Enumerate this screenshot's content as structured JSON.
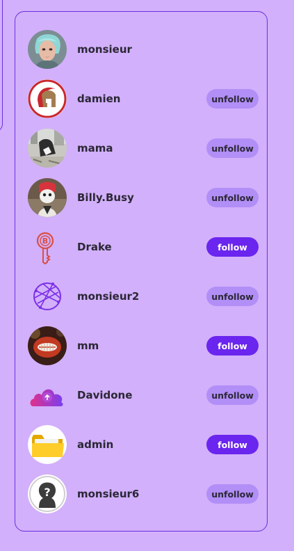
{
  "users": [
    {
      "name": "monsieur",
      "button": ""
    },
    {
      "name": "damien",
      "button": "unfollow"
    },
    {
      "name": "mama",
      "button": "unfollow"
    },
    {
      "name": "Billy.Busy",
      "button": "unfollow"
    },
    {
      "name": "Drake",
      "button": "follow"
    },
    {
      "name": "monsieur2",
      "button": "unfollow"
    },
    {
      "name": "mm",
      "button": "follow"
    },
    {
      "name": "Davidone",
      "button": "unfollow"
    },
    {
      "name": "admin",
      "button": "follow"
    },
    {
      "name": "monsieur6",
      "button": "unfollow"
    }
  ],
  "colors": {
    "page_background": "#d2b0fb",
    "border": "#6a2fe0",
    "follow_button": "#6a25ee",
    "unfollow_button": "#b28ef7",
    "text": "#2b2736"
  },
  "avatars": [
    "woman-portrait-avatar",
    "spartan-helmet-avatar",
    "photo-avatar",
    "photo-avatar",
    "bitcoin-key-icon",
    "globe-network-icon",
    "photo-avatar",
    "cloud-upload-icon",
    "folder-icon",
    "question-person-icon"
  ]
}
